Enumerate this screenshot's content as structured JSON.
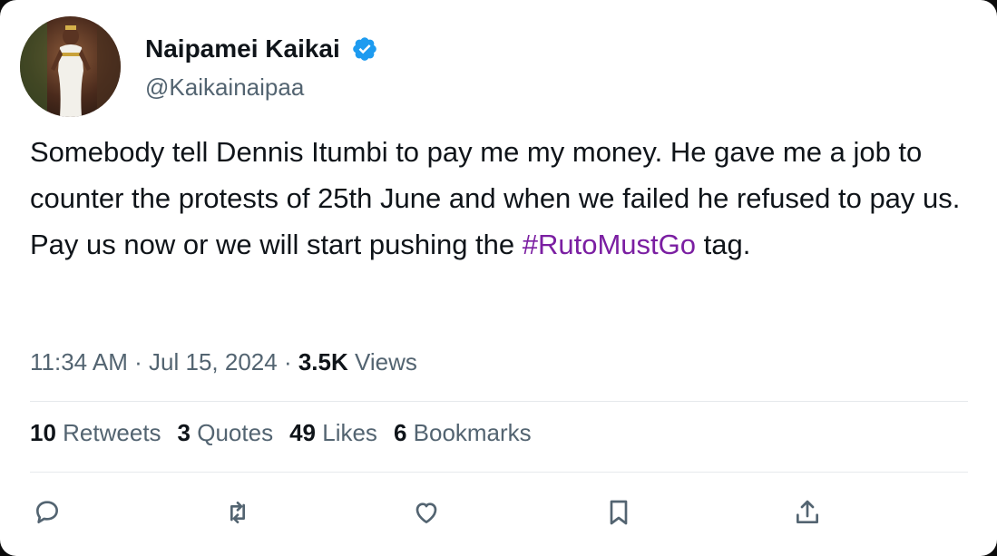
{
  "author": {
    "display_name": "Naipamei Kaikai",
    "handle": "@Kaikainaipaa",
    "verified": true
  },
  "tweet": {
    "text_part1": "Somebody tell Dennis Itumbi to pay me my money. He gave me a job to counter the protests of 25th June and when we failed he refused to pay us. Pay us now or we will start pushing the ",
    "hashtag": "#RutoMustGo",
    "text_part2": " tag."
  },
  "meta": {
    "time": "11:34 AM",
    "sep1": " · ",
    "date": "Jul 15, 2024",
    "sep2": " · ",
    "views_count": "3.5K",
    "views_label": "Views"
  },
  "stats": {
    "retweets_count": "10",
    "retweets_label": "Retweets",
    "quotes_count": "3",
    "quotes_label": "Quotes",
    "likes_count": "49",
    "likes_label": "Likes",
    "bookmarks_count": "6",
    "bookmarks_label": "Bookmarks"
  },
  "actions": {
    "reply_icon": "reply-icon",
    "retweet_icon": "retweet-icon",
    "like_icon": "heart-icon",
    "bookmark_icon": "bookmark-icon",
    "share_icon": "share-icon"
  },
  "colors": {
    "text": "#0f1419",
    "secondary": "#536471",
    "hashtag": "#7b1fa2",
    "verified": "#1d9bf0",
    "icon": "#536471"
  }
}
